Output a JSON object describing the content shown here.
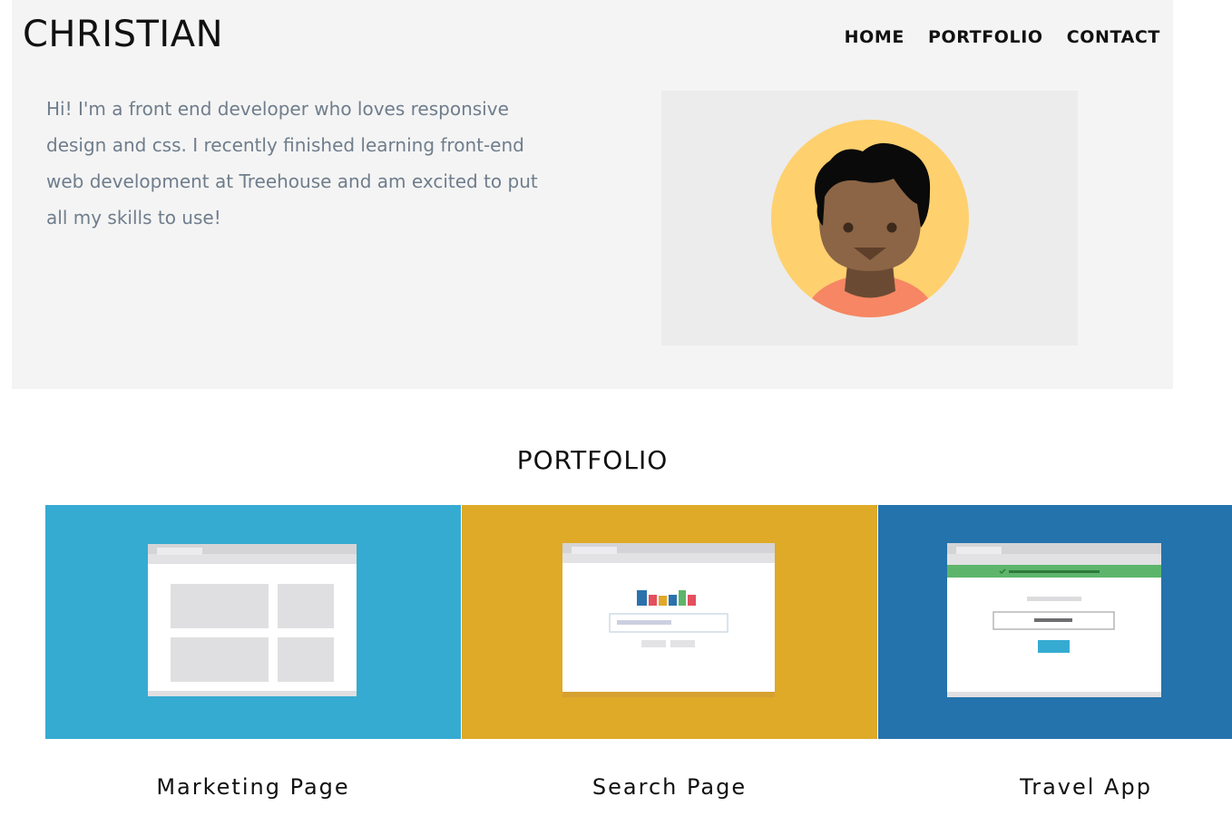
{
  "header": {
    "logo": "CHRISTIAN",
    "nav": [
      "HOME",
      "PORTFOLIO",
      "CONTACT"
    ]
  },
  "hero": {
    "intro": "Hi! I'm a front end developer who loves responsive design and css. I recently finished learning front-end web development at Treehouse and am excited to put all my skills to use!",
    "avatar_icon": "person-avatar-icon"
  },
  "portfolio": {
    "title": "PORTFOLIO",
    "items": [
      {
        "label": "Marketing Page",
        "color": "#36abd2",
        "icon": "marketing-page-thumbnail"
      },
      {
        "label": "Search Page",
        "color": "#dfaa28",
        "icon": "search-page-thumbnail"
      },
      {
        "label": "Travel App",
        "color": "#2473ac",
        "icon": "travel-app-thumbnail"
      }
    ]
  },
  "colors": {
    "hero_bg": "#f4f4f4",
    "intro_text": "#6f7d8c",
    "avatar_bg": "#ececec",
    "avatar_circle": "#fed06e",
    "skin": "#8b6545",
    "shirt": "#f68664"
  }
}
